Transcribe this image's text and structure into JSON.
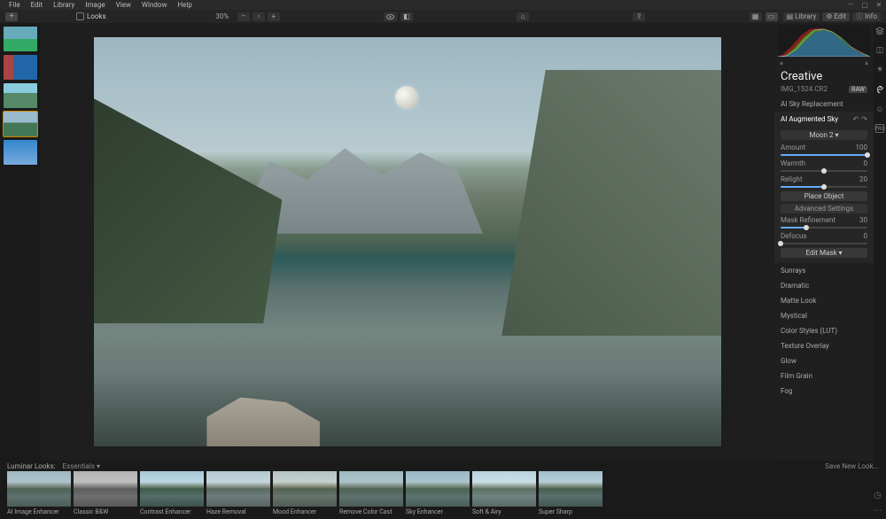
{
  "menus": {
    "file": "File",
    "edit": "Edit",
    "library": "Library",
    "image": "Image",
    "view": "View",
    "window": "Window",
    "help": "Help"
  },
  "wincontrols": {
    "min": "—",
    "max": "▢",
    "close": "✕"
  },
  "toolbar": {
    "plus": "+",
    "looks_label": "Looks",
    "zoom_value": "30%",
    "zoom_minus": "–",
    "zoom_plus": "+",
    "library": "Library",
    "edit": "Edit",
    "info": "Info"
  },
  "panel": {
    "title": "Creative",
    "filename": "IMG_1524.CR2",
    "raw_badge": "RAW",
    "tools": {
      "sky_replacement": "AI Sky Replacement",
      "augmented_sky": "AI Augmented Sky",
      "sunrays": "Sunrays",
      "dramatic": "Dramatic",
      "matte_look": "Matte Look",
      "mystical": "Mystical",
      "color_styles": "Color Styles (LUT)",
      "texture_overlay": "Texture Overlay",
      "glow": "Glow",
      "film_grain": "Film Grain",
      "fog": "Fog"
    },
    "aug": {
      "object_select": "Moon 2 ▾",
      "amount_label": "Amount",
      "amount_value": "100",
      "warmth_label": "Warmth",
      "warmth_value": "0",
      "relight_label": "Relight",
      "relight_value": "20",
      "place_object": "Place Object",
      "advanced_settings": "Advanced Settings",
      "mask_refinement_label": "Mask Refinement",
      "mask_refinement_value": "30",
      "defocus_label": "Defocus",
      "defocus_value": "0",
      "edit_mask": "Edit Mask ▾",
      "undo": "↶",
      "redo": "↷"
    }
  },
  "looks": {
    "label": "Luminar Looks:",
    "category": "Essentials ▾",
    "save": "Save New Look...",
    "items": [
      "AI Image Enhancer",
      "Classic B&W",
      "Contrast Enhancer",
      "Haze Removal",
      "Mood Enhancer",
      "Remove Color Cast",
      "Sky Enhancer",
      "Soft & Airy",
      "Super Sharp"
    ]
  },
  "thumbs": {
    "count": 5,
    "selected": 3
  }
}
